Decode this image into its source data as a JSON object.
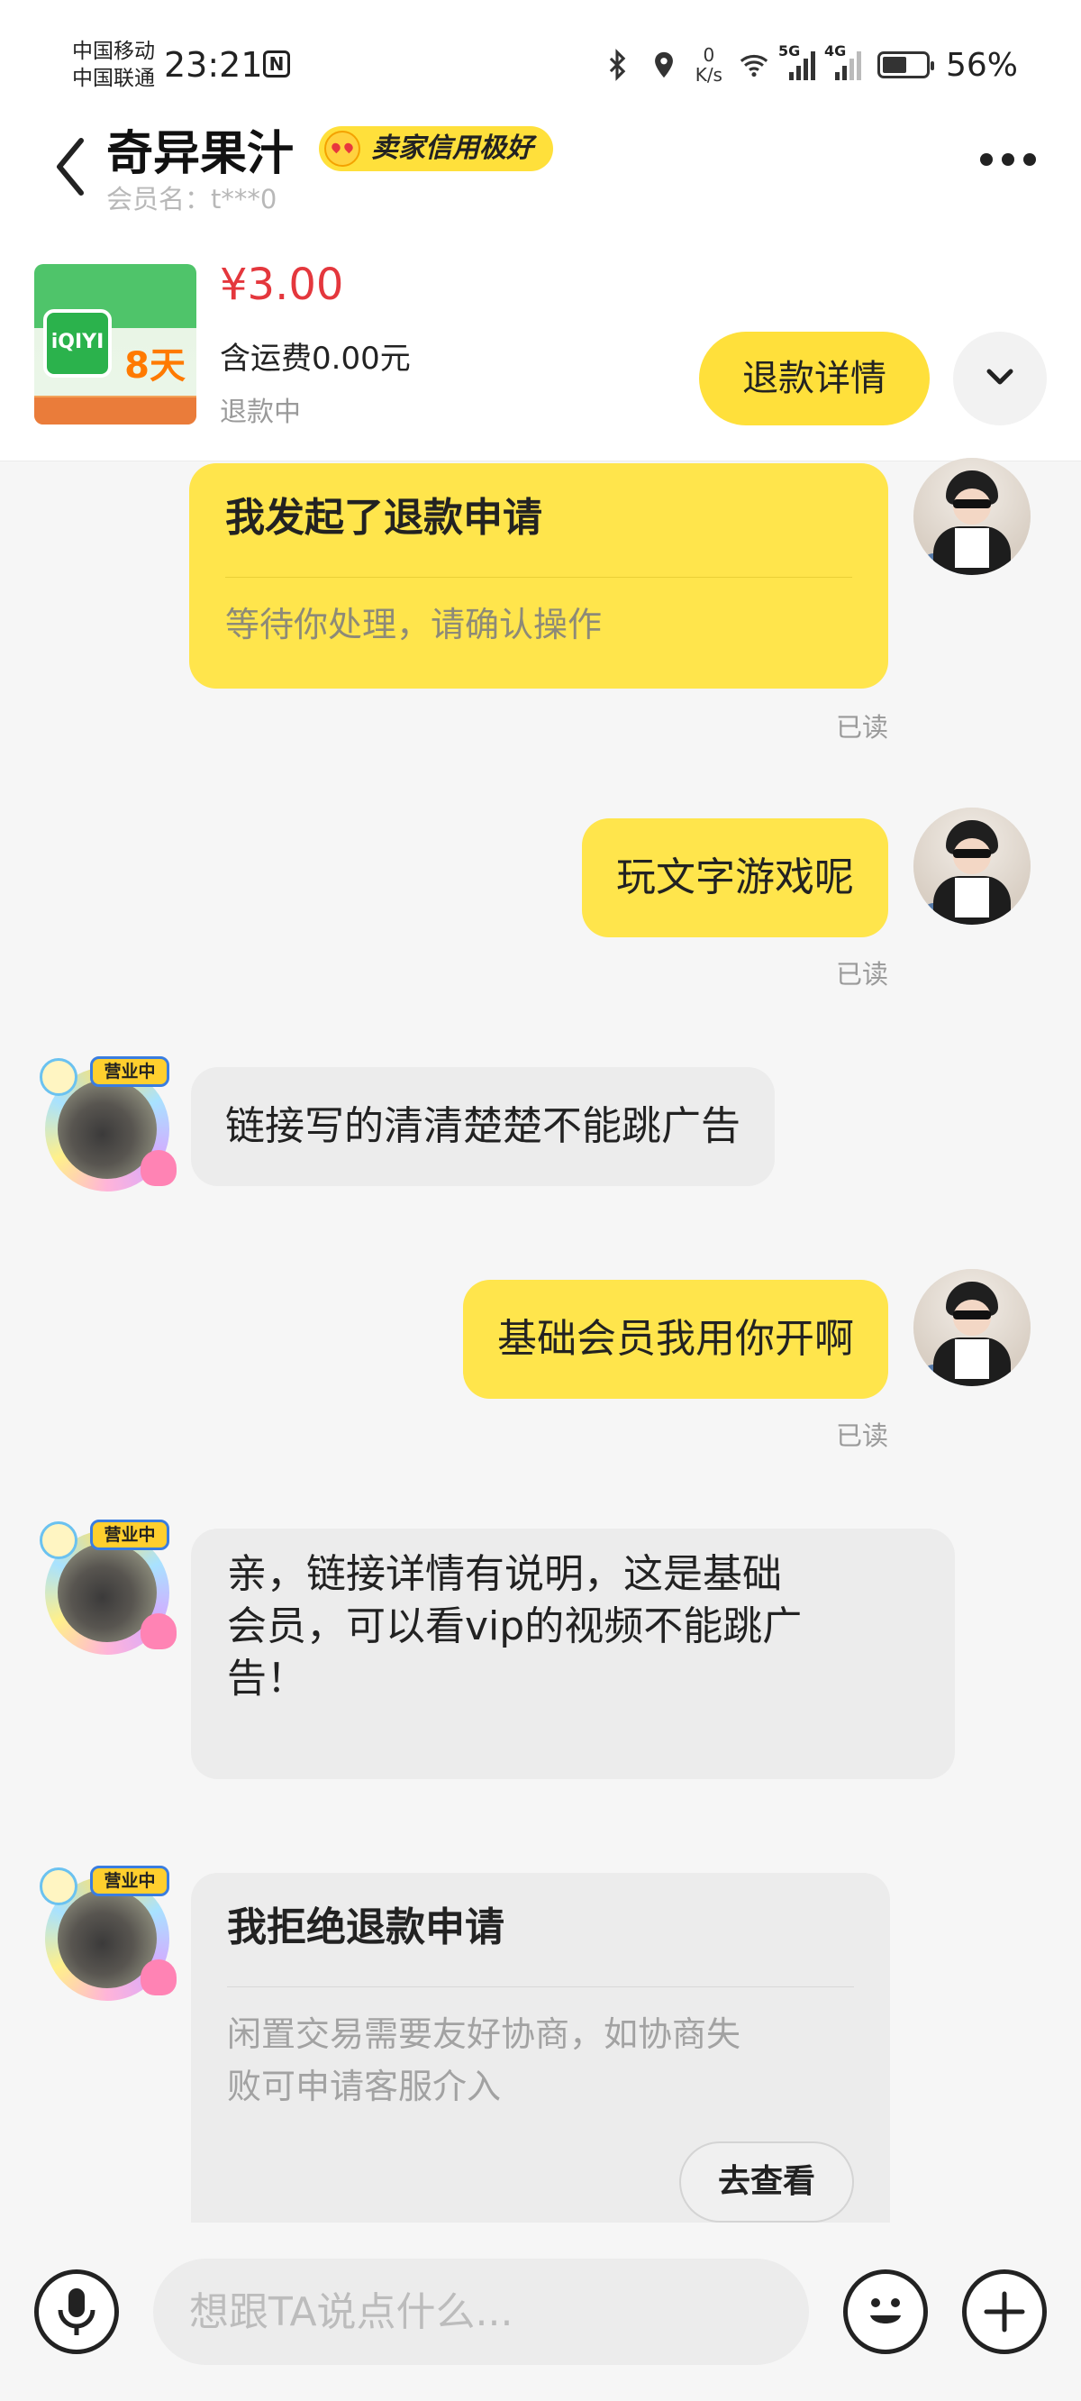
{
  "status_bar": {
    "carrier_1": "中国移动",
    "carrier_2": "中国联通",
    "time": "23:21",
    "net_speed_value": "0",
    "net_speed_unit": "K/s",
    "signal_1": "5G",
    "signal_2": "4G",
    "battery_percent_label": "56%",
    "battery_level": 0.56
  },
  "header": {
    "shop_name": "奇异果汁",
    "credit_badge": "卖家信用极好",
    "member_label": "会员名：t***0"
  },
  "product": {
    "price": "¥3.00",
    "shipping": "含运费0.00元",
    "status": "退款中",
    "refund_button": "退款详情",
    "thumb_brand": "iQIYI",
    "thumb_days": "8天"
  },
  "messages": [
    {
      "side": "mine",
      "type": "card",
      "title": "我发起了退款申请",
      "subtitle": "等待你处理，请确认操作",
      "read": "已读"
    },
    {
      "side": "mine",
      "type": "text",
      "text": "玩文字游戏呢",
      "read": "已读"
    },
    {
      "side": "theirs",
      "type": "text",
      "text": "链接写的清清楚楚不能跳广告"
    },
    {
      "side": "mine",
      "type": "text",
      "text": "基础会员我用你开啊",
      "read": "已读"
    },
    {
      "side": "theirs",
      "type": "text",
      "text_lines": [
        "亲，链接详情有说明，这是基础",
        "会员，可以看vip的视频不能跳广",
        "告！"
      ]
    },
    {
      "side": "theirs",
      "type": "card",
      "title": "我拒绝退款申请",
      "subtitle_lines": [
        "闲置交易需要友好协商，如协商失",
        "败可申请客服介入"
      ],
      "button": "去查看"
    }
  ],
  "seller_avatar_tag": "营业中",
  "input": {
    "placeholder": "想跟TA说点什么..."
  },
  "colors": {
    "accent_yellow": "#ffe54c",
    "price_red": "#e4373d",
    "their_bubble": "#ececec"
  }
}
